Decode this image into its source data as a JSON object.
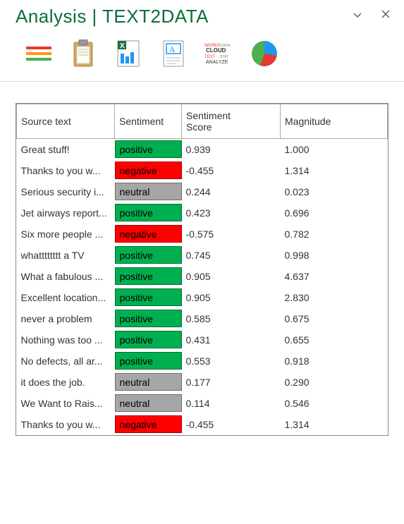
{
  "header": {
    "title": "Analysis | TEXT2DATA"
  },
  "toolbar": {
    "icons": [
      "bullets-icon",
      "clipboard-icon",
      "excel-icon",
      "text-doc-icon",
      "wordcloud-icon",
      "piechart-icon"
    ]
  },
  "table": {
    "columns": [
      "Source text",
      "Sentiment",
      "Sentiment Score",
      "Magnitude"
    ],
    "rows": [
      {
        "text": "Great stuff!",
        "sentiment": "positive",
        "score": "0.939",
        "magnitude": "1.000"
      },
      {
        "text": "Thanks to you w...",
        "sentiment": "negative",
        "score": "-0.455",
        "magnitude": "1.314"
      },
      {
        "text": "Serious security i...",
        "sentiment": "neutral",
        "score": "0.244",
        "magnitude": "0.023"
      },
      {
        "text": "Jet airways report...",
        "sentiment": "positive",
        "score": "0.423",
        "magnitude": "0.696"
      },
      {
        "text": "Six more people ...",
        "sentiment": "negative",
        "score": "-0.575",
        "magnitude": "0.782"
      },
      {
        "text": "whatttttttt a TV",
        "sentiment": "positive",
        "score": "0.745",
        "magnitude": "0.998"
      },
      {
        "text": "What a fabulous ...",
        "sentiment": "positive",
        "score": "0.905",
        "magnitude": "4.637"
      },
      {
        "text": "Excellent location...",
        "sentiment": "positive",
        "score": "0.905",
        "magnitude": "2.830"
      },
      {
        "text": "never a problem",
        "sentiment": "positive",
        "score": "0.585",
        "magnitude": "0.675"
      },
      {
        "text": "Nothing was too ...",
        "sentiment": "positive",
        "score": "0.431",
        "magnitude": "0.655"
      },
      {
        "text": "No defects, all ar...",
        "sentiment": "positive",
        "score": "0.553",
        "magnitude": "0.918"
      },
      {
        "text": "it does the job.",
        "sentiment": "neutral",
        "score": "0.177",
        "magnitude": "0.290"
      },
      {
        "text": "We Want to Rais...",
        "sentiment": "neutral",
        "score": "0.114",
        "magnitude": "0.546"
      },
      {
        "text": "Thanks to you w...",
        "sentiment": "negative",
        "score": "-0.455",
        "magnitude": "1.314"
      }
    ]
  },
  "chart_data": {
    "type": "table",
    "title": "Sentiment Analysis Results",
    "columns": [
      "Source text",
      "Sentiment",
      "Sentiment Score",
      "Magnitude"
    ],
    "rows": [
      [
        "Great stuff!",
        "positive",
        0.939,
        1.0
      ],
      [
        "Thanks to you w...",
        "negative",
        -0.455,
        1.314
      ],
      [
        "Serious security i...",
        "neutral",
        0.244,
        0.023
      ],
      [
        "Jet airways report...",
        "positive",
        0.423,
        0.696
      ],
      [
        "Six more people ...",
        "negative",
        -0.575,
        0.782
      ],
      [
        "whatttttttt a TV",
        "positive",
        0.745,
        0.998
      ],
      [
        "What a fabulous ...",
        "positive",
        0.905,
        4.637
      ],
      [
        "Excellent location...",
        "positive",
        0.905,
        2.83
      ],
      [
        "never a problem",
        "positive",
        0.585,
        0.675
      ],
      [
        "Nothing was too ...",
        "positive",
        0.431,
        0.655
      ],
      [
        "No defects, all ar...",
        "positive",
        0.553,
        0.918
      ],
      [
        "it does the job.",
        "neutral",
        0.177,
        0.29
      ],
      [
        "We Want to Rais...",
        "neutral",
        0.114,
        0.546
      ],
      [
        "Thanks to you w...",
        "negative",
        -0.455,
        1.314
      ]
    ]
  }
}
